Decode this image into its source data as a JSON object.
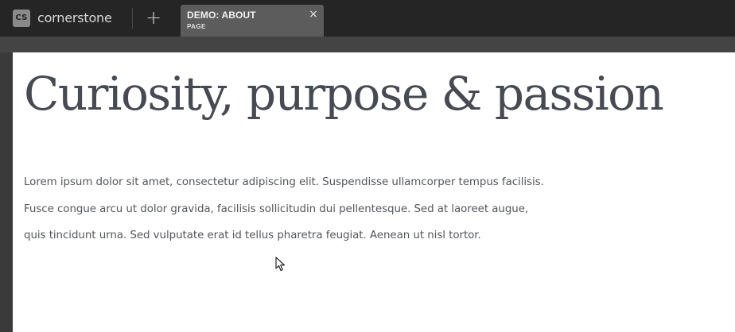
{
  "app": {
    "brand_name": "cornerstone",
    "logo_text": "CS"
  },
  "toolbar": {
    "add_label": "+"
  },
  "tabs": [
    {
      "title": "DEMO: ABOUT",
      "subtitle": "PAGE",
      "close_label": "×",
      "active": true
    }
  ],
  "page": {
    "headline": "Curiosity, purpose & passion",
    "body": "Lorem ipsum dolor sit amet, consectetur adipiscing elit. Suspendisse ullamcorper tempus facilisis. Fusce congue arcu ut dolor gravida, facilisis sollicitudin dui pellentesque. Sed at laoreet augue, quis tincidunt urna. Sed vulputate erat id tellus pharetra feugiat. Aenean ut nisl tortor."
  },
  "colors": {
    "topbar": "#252525",
    "tab_active": "#5c5c5c",
    "canvas": "#ffffff",
    "headline": "#474a52",
    "body_text": "#53565c"
  },
  "icons": {
    "logo": "cornerstone-logo-icon",
    "add": "plus-icon",
    "close": "close-icon",
    "pointer": "mouse-cursor-icon"
  }
}
